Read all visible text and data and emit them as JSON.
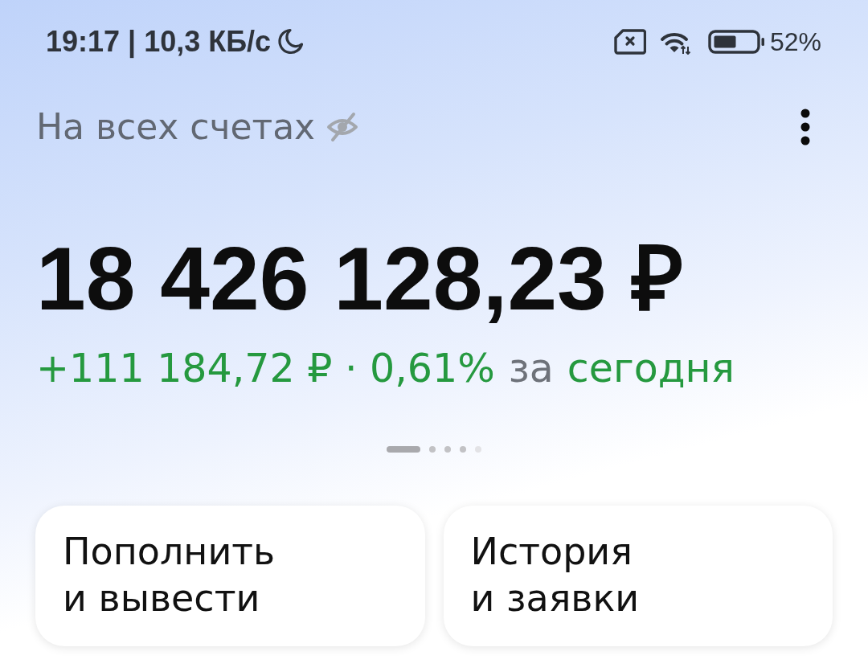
{
  "status_bar": {
    "time": "19:17 | 10,3 КБ/с",
    "battery": "52%"
  },
  "header": {
    "title": "На всех счетах"
  },
  "balance": {
    "amount": "18 426 128,23 ₽",
    "change": "+111 184,72 ₽ · 0,61%",
    "period_prefix": "за",
    "period": "сегодня"
  },
  "pager": [
    {
      "selected": true,
      "faded": false
    },
    {
      "selected": false,
      "faded": false
    },
    {
      "selected": false,
      "faded": false
    },
    {
      "selected": false,
      "faded": false
    },
    {
      "selected": false,
      "faded": true
    }
  ],
  "actions": [
    {
      "label": "Пополнить\nи вывести"
    },
    {
      "label": "История\nи заявки"
    }
  ]
}
